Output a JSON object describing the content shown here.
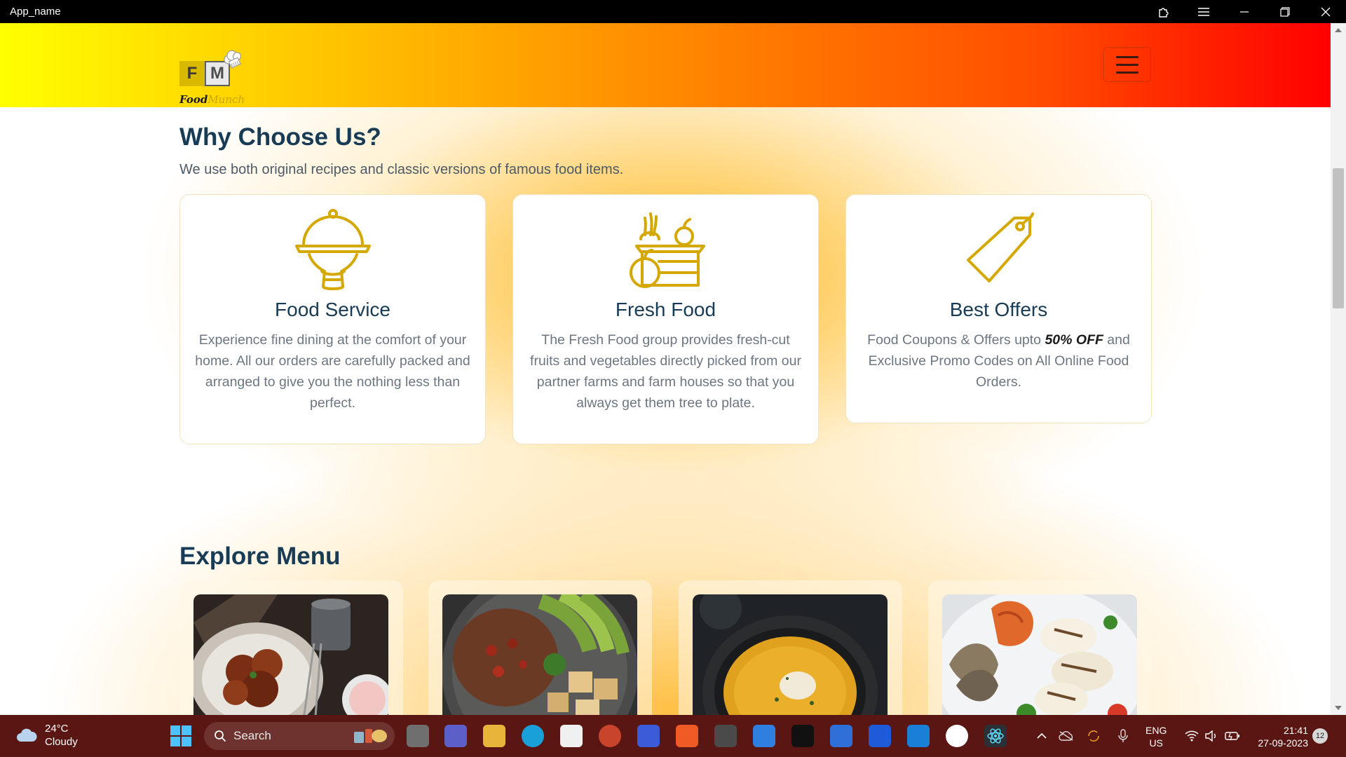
{
  "window": {
    "app_name": "App_name"
  },
  "header": {
    "logo_letters": [
      "F",
      "M"
    ],
    "brand_first": "Food",
    "brand_second": "Munch",
    "menu_icon": "hamburger-icon"
  },
  "why_section": {
    "title": "Why Choose Us?",
    "description": "We use both original recipes and classic versions of famous food items.",
    "cards": [
      {
        "icon": "cloche-serving-icon",
        "title": "Food Service",
        "text": "Experience fine dining at the comfort of your home. All our orders are carefully packed and arranged to give you the nothing less than perfect."
      },
      {
        "icon": "fresh-produce-basket-icon",
        "title": "Fresh Food",
        "text": "The Fresh Food group provides fresh-cut fruits and vegetables directly picked from our partner farms and farm houses so that you always get them tree to plate."
      },
      {
        "icon": "price-tag-icon",
        "title": "Best Offers",
        "text_before": "Food Coupons & Offers upto ",
        "text_bold": "50% OFF",
        "text_after": " and Exclusive Promo Codes on All Online Food Orders."
      }
    ]
  },
  "menu_section": {
    "title": "Explore Menu",
    "items": [
      {
        "image": "fried-chicken-photo"
      },
      {
        "image": "rice-bowl-avocado-photo"
      },
      {
        "image": "pumpkin-soup-photo"
      },
      {
        "image": "seafood-platter-photo"
      }
    ]
  },
  "taskbar": {
    "weather_temp": "24°C",
    "weather_desc": "Cloudy",
    "search_label": "Search",
    "language": "ENG",
    "region": "US",
    "time": "21:41",
    "date": "27-09-2023",
    "notification_count": "12"
  },
  "colors": {
    "heading": "#183b56",
    "body_text": "#6c7681",
    "accent_icon": "#d4a800"
  }
}
